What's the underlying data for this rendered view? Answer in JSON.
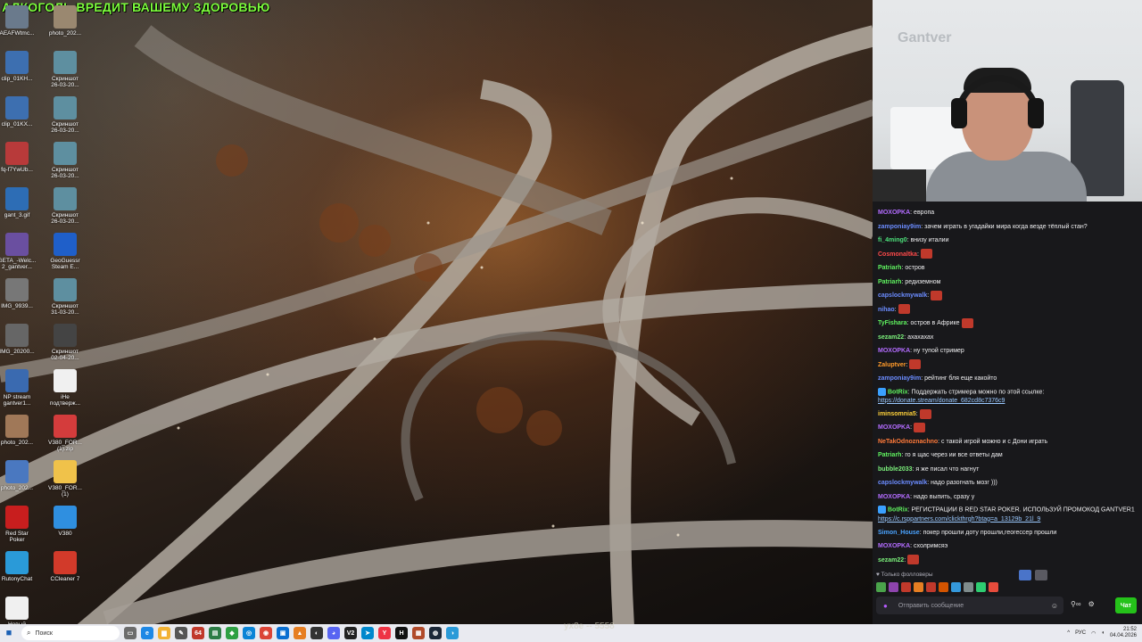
{
  "banner": {
    "warning": "АЛКОГОЛЬ ВРЕДИТ ВАШЕМУ ЗДОРОВЬЮ"
  },
  "desktop_icons": [
    {
      "name": "AEAFWtmc...",
      "icon": "image-file-icon",
      "color": "#6a7a8c"
    },
    {
      "name": "photo_202...",
      "icon": "photo-icon",
      "color": "#9a8870"
    },
    {
      "name": "clip_01KH...",
      "icon": "video-file-icon",
      "color": "#3d6fb0"
    },
    {
      "name": "Скриншот\n26-03-20...",
      "icon": "screenshot-icon",
      "color": "#5e8fa0"
    },
    {
      "name": "clip_01KX...",
      "icon": "video-file-icon",
      "color": "#3d6fb0"
    },
    {
      "name": "Скриншот\n26-03-20...",
      "icon": "screenshot-icon",
      "color": "#5e8fa0"
    },
    {
      "name": "fq-f7YwUb...",
      "icon": "image-file-icon",
      "color": "#b83a3a"
    },
    {
      "name": "Скриншот\n26-03-20...",
      "icon": "screenshot-icon",
      "color": "#5e8fa0"
    },
    {
      "name": "gant_3.gif",
      "icon": "gif-file-icon",
      "color": "#2d6db5"
    },
    {
      "name": "Скриншот\n26-03-20...",
      "icon": "screenshot-icon",
      "color": "#5e8fa0"
    },
    {
      "name": "GETA_-Welc...\n2_gantver...",
      "icon": "image-file-icon",
      "color": "#6a4fa0"
    },
    {
      "name": "GeoGuessr\nSteam E...",
      "icon": "geoguessr-icon",
      "color": "#1f5fc9"
    },
    {
      "name": "IMG_9939...",
      "icon": "photo-icon",
      "color": "#777"
    },
    {
      "name": "Скриншот\n31-03-20...",
      "icon": "screenshot-icon",
      "color": "#5e8fa0"
    },
    {
      "name": "IMG_20200...",
      "icon": "photo-icon",
      "color": "#666"
    },
    {
      "name": "Скриншот\n02-04-20...",
      "icon": "screenshot-icon",
      "color": "#444"
    },
    {
      "name": "NP stream\ngantver1...",
      "icon": "document-icon",
      "color": "#3a6ab0"
    },
    {
      "name": "iHe\nподтверж...",
      "icon": "text-file-icon",
      "color": "#f0f0f0"
    },
    {
      "name": "photo_202...",
      "icon": "photo-icon",
      "color": "#a07858"
    },
    {
      "name": "V380_FOR...\n(1).zip",
      "icon": "zip-file-icon",
      "color": "#d43c3c"
    },
    {
      "name": "photo_202...",
      "icon": "photo-icon",
      "color": "#4a78c0"
    },
    {
      "name": "V380_FOR...\n(1)",
      "icon": "folder-icon",
      "color": "#f0c24a"
    },
    {
      "name": "Red Star\nPoker",
      "icon": "red-star-poker-icon",
      "color": "#c81e1e"
    },
    {
      "name": "V380",
      "icon": "v380-app-icon",
      "color": "#2f8fe0"
    },
    {
      "name": "RutonyChat",
      "icon": "rutonychat-icon",
      "color": "#2a9ad8"
    },
    {
      "name": "CCleaner 7",
      "icon": "ccleaner-icon",
      "color": "#d23a2a"
    },
    {
      "name": "Новый\nтекстовый...",
      "icon": "text-file-icon",
      "color": "#f0f0f0"
    }
  ],
  "chat": {
    "messages": [
      {
        "user": "MOXOPKA",
        "color": "#b36cff",
        "text": ": европа",
        "emote": false
      },
      {
        "user": "zamponiay9im",
        "color": "#6b8cff",
        "text": ": зачем играть в угадайки мира когда везде тёплый стан?",
        "emote": false
      },
      {
        "user": "fi_4ming0",
        "color": "#4ce07a",
        "text": ": внизу италии",
        "emote": false
      },
      {
        "user": "Cosmonaltka",
        "color": "#ff4a4a",
        "text": ":",
        "emote": true
      },
      {
        "user": "Patriarh",
        "color": "#5ff25f",
        "text": ": остров",
        "emote": false
      },
      {
        "user": "Patriarh",
        "color": "#5ff25f",
        "text": ": редиземном",
        "emote": false
      },
      {
        "user": "capslockmywalk",
        "color": "#6b8cff",
        "text": ":",
        "emote": true
      },
      {
        "user": "nihao",
        "color": "#6b8cff",
        "text": ":",
        "emote": true
      },
      {
        "user": "TyFishara",
        "color": "#5ff25f",
        "text": ": остров в Африке",
        "emote": true
      },
      {
        "user": "sezam22",
        "color": "#7cf27c",
        "text": ": ахахахах",
        "emote": false
      },
      {
        "user": "MOXOPKA",
        "color": "#b36cff",
        "text": ": ну тупой стример",
        "emote": false
      },
      {
        "user": "Zaluptver",
        "color": "#ff9a2a",
        "text": ":",
        "emote": true
      },
      {
        "user": "zamponiay9im",
        "color": "#6b8cff",
        "text": ": рейтинг бля еще какойто",
        "emote": false
      },
      {
        "user": "BotRix",
        "color": "#5ff25f",
        "text": ": Поддержать стримера можно по этой ссылке:",
        "emote": false,
        "link": "https://donate.stream/donate_682cd8c7376c9"
      },
      {
        "user": "iminsomnia5",
        "color": "#ffd23a",
        "text": ":",
        "emote": true
      },
      {
        "user": "MOXOPKA",
        "color": "#b36cff",
        "text": ":",
        "emote": true
      },
      {
        "user": "NeTakOdnoznachno",
        "color": "#ff7a3a",
        "text": ": с такой игрой можно и с Дони играть",
        "emote": false
      },
      {
        "user": "Patriarh",
        "color": "#5ff25f",
        "text": ": го я щас через ии все ответы дам",
        "emote": false
      },
      {
        "user": "bubble2033",
        "color": "#7cf27c",
        "text": ": я же писал что нагнут",
        "emote": false
      },
      {
        "user": "capslockmywalk",
        "color": "#6b8cff",
        "text": ": надо разогнать мозг )))",
        "emote": false
      },
      {
        "user": "MOXOPKA",
        "color": "#b36cff",
        "text": ": надо выпить, сразу у",
        "emote": false
      },
      {
        "user": "BotRix",
        "color": "#5ff25f",
        "text": ": РЕГИСТРАЦИИ В RED STAR POKER. ИСПОЛЬЗУЙ ПРОМОКОД GANTVER1",
        "emote": false,
        "link": "https://c.rsppartners.com/clickthrgh?btag=a_13129b_21l_9"
      },
      {
        "user": "Simon_House",
        "color": "#4aa3ff",
        "text": ": покер прошли доту прошли,геогессер прошли",
        "emote": false
      },
      {
        "user": "MOXOPKA",
        "color": "#b36cff",
        "text": ": схолримсяэ",
        "emote": false
      },
      {
        "user": "sezam22",
        "color": "#7cf27c",
        "text": ":",
        "emote": true
      }
    ],
    "followers_only": "♥ Только фолловеры",
    "input_placeholder": "Отправить сообщение",
    "send_label": "Чат"
  },
  "taskbar": {
    "search_label": "Поиск",
    "overlay_text": "yx8e -- 5558",
    "language": "РУС",
    "time": "21:52",
    "date": "04.04.2026"
  },
  "webcam": {
    "wall_logo": "Gantver"
  }
}
